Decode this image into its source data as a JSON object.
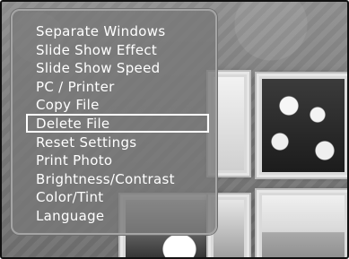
{
  "menu": {
    "items": [
      {
        "label": "Separate Windows"
      },
      {
        "label": "Slide Show Effect"
      },
      {
        "label": "Slide Show Speed"
      },
      {
        "label": "PC / Printer"
      },
      {
        "label": "Copy File"
      },
      {
        "label": "Delete File"
      },
      {
        "label": "Reset Settings"
      },
      {
        "label": "Print Photo"
      },
      {
        "label": "Brightness/Contrast"
      },
      {
        "label": "Color/Tint"
      },
      {
        "label": "Language"
      }
    ],
    "selected_index": 5
  },
  "colors": {
    "menu_text": "#ffffff",
    "selection_outline": "#ffffff",
    "frame_border": "#111111"
  }
}
